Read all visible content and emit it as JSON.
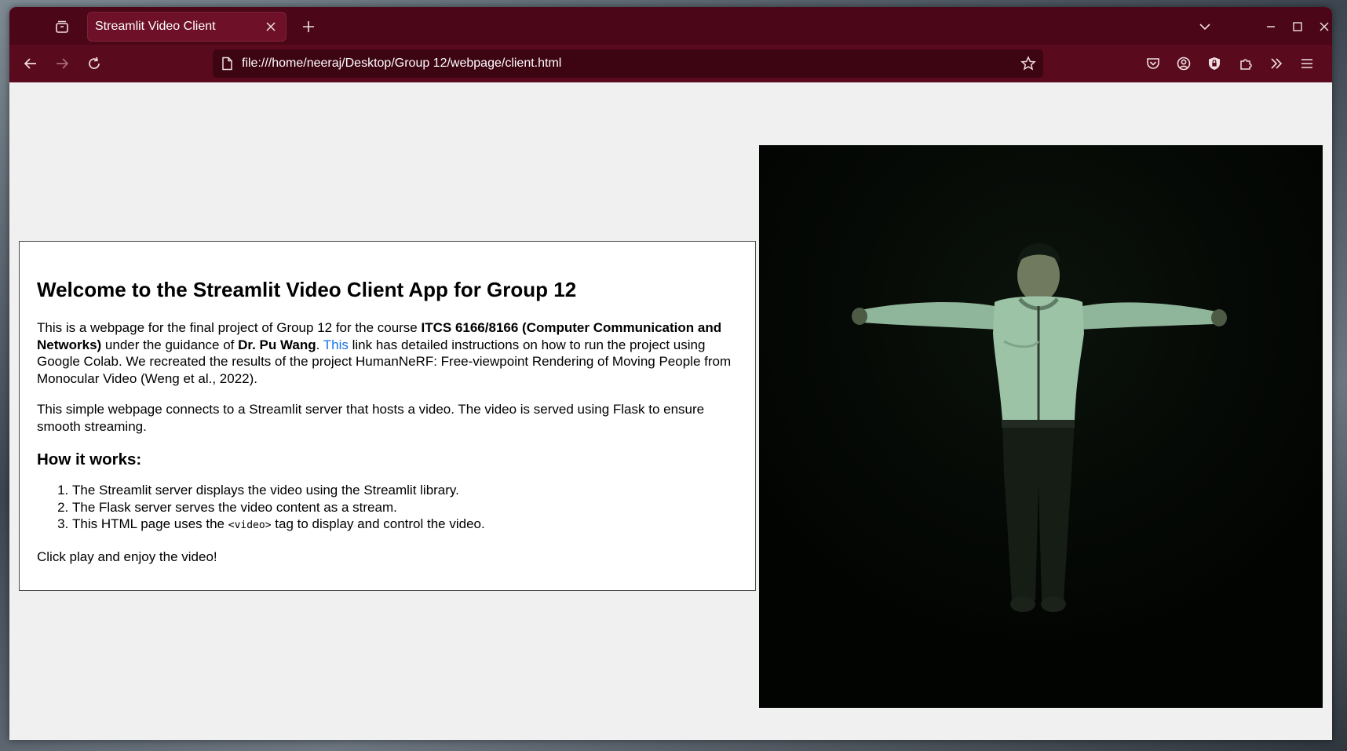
{
  "browser": {
    "tab_title": "Streamlit Video Client",
    "url": "file:///home/neeraj/Desktop/Group 12/webpage/client.html"
  },
  "page": {
    "title": "Welcome to the Streamlit Video Client App for Group 12",
    "intro": {
      "part1": "This is a webpage for the final project of Group 12 for the course ",
      "course": "ITCS 6166/8166 (Computer Communication and Networks)",
      "part2": " under the guidance of ",
      "professor": "Dr. Pu Wang",
      "part3": ". ",
      "link_text": "This",
      "part4": " link has detailed instructions on how to run the project using Google Colab. We recreated the results of the project HumanNeRF: Free-viewpoint Rendering of Moving People from Monocular Video (Weng et al., 2022)."
    },
    "description": "This simple webpage connects to a Streamlit server that hosts a video. The video is served using Flask to ensure smooth streaming.",
    "how_heading": "How it works:",
    "steps": {
      "s1": "The Streamlit server displays the video using the Streamlit library.",
      "s2": "The Flask server serves the video content as a stream.",
      "s3_pre": "This HTML page uses the ",
      "s3_code": "<video>",
      "s3_post": " tag to display and control the video."
    },
    "closing": "Click play and enjoy the video!"
  },
  "icons": {
    "tab_list": "tab-list-icon",
    "close": "close-icon",
    "new_tab": "plus-icon",
    "back": "back-arrow-icon",
    "forward": "forward-arrow-icon",
    "reload": "reload-icon",
    "page": "page-icon",
    "bookmark": "star-icon",
    "pocket": "pocket-icon",
    "account": "account-icon",
    "shield": "shield-icon",
    "extensions": "puzzle-icon",
    "overflow": "double-chevron-icon",
    "menu": "hamburger-menu-icon"
  },
  "colors": {
    "titlebar": "#4b0617",
    "navbar": "#5a0a1d",
    "link": "#1a73e8"
  }
}
